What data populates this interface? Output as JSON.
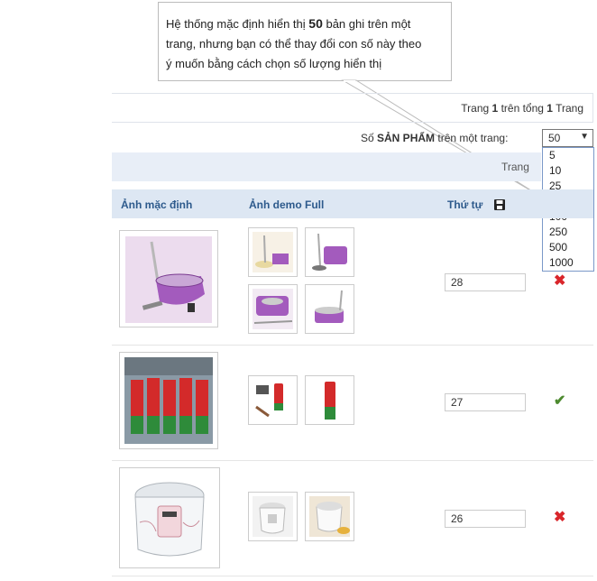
{
  "tooltip": {
    "line1_pre": "Hệ thống mặc định hiển thị ",
    "line1_num": "50",
    "line1_post": " bản ghi trên một",
    "line2": "trang, nhưng bạn có thể thay đổi con số này theo",
    "line3": "ý muốn bằng cách chọn số lượng hiển thị"
  },
  "pager": {
    "pre": "Trang ",
    "page": "1",
    "mid": " trên tổng ",
    "total": "1",
    "post": " Trang"
  },
  "per_page": {
    "pre": "Số ",
    "bold": "SẢN PHẨM",
    "post": " trên một trang:",
    "selected": "50",
    "options": [
      "5",
      "10",
      "25",
      "50",
      "100",
      "250",
      "500",
      "1000"
    ]
  },
  "bar1_text": "Trang",
  "columns": {
    "main_image": "Ảnh mặc định",
    "demo_images": "Ảnh demo Full",
    "order": "Thứ tự",
    "save_icon": "save-icon"
  },
  "rows": [
    {
      "name": "mop",
      "order": "28",
      "status_icon": "x-icon"
    },
    {
      "name": "spray",
      "order": "27",
      "status_icon": "check-icon"
    },
    {
      "name": "rice-cooker",
      "order": "26",
      "status_icon": "x-icon"
    }
  ],
  "colors": {
    "header_bg": "#dde7f3",
    "header_text": "#2d5a8c",
    "select_highlight": "#3399ff",
    "x_color": "#d9262b",
    "check_color": "#4d8a2f"
  }
}
